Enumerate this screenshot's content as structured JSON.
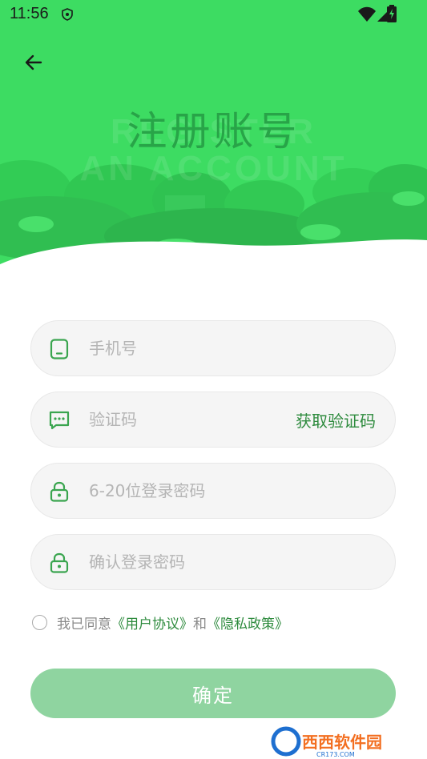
{
  "status_bar": {
    "time": "11:56"
  },
  "header": {
    "title": "注册账号",
    "watermark_line1": "REGISTER",
    "watermark_line2": "AN ACCOUNT"
  },
  "form": {
    "phone": {
      "placeholder": "手机号",
      "value": ""
    },
    "code": {
      "placeholder": "验证码",
      "value": "",
      "get_code_label": "获取验证码"
    },
    "password": {
      "placeholder": "6-20位登录密码",
      "value": ""
    },
    "confirm_password": {
      "placeholder": "确认登录密码",
      "value": ""
    }
  },
  "agreement": {
    "prefix": "我已同意",
    "user_agreement": "《用户协议》",
    "and": "和",
    "privacy_policy": "《隐私政策》"
  },
  "submit_label": "确定",
  "watermark_badge": {
    "brand": "西西软件园",
    "site": "CR173.COM"
  },
  "colors": {
    "hero_green": "#3ddc62",
    "accent": "#2e8b3e",
    "button": "#8fd4a0",
    "icon": "#3aa54f"
  },
  "icons": [
    "back-arrow",
    "phone",
    "message",
    "lock",
    "lock"
  ]
}
